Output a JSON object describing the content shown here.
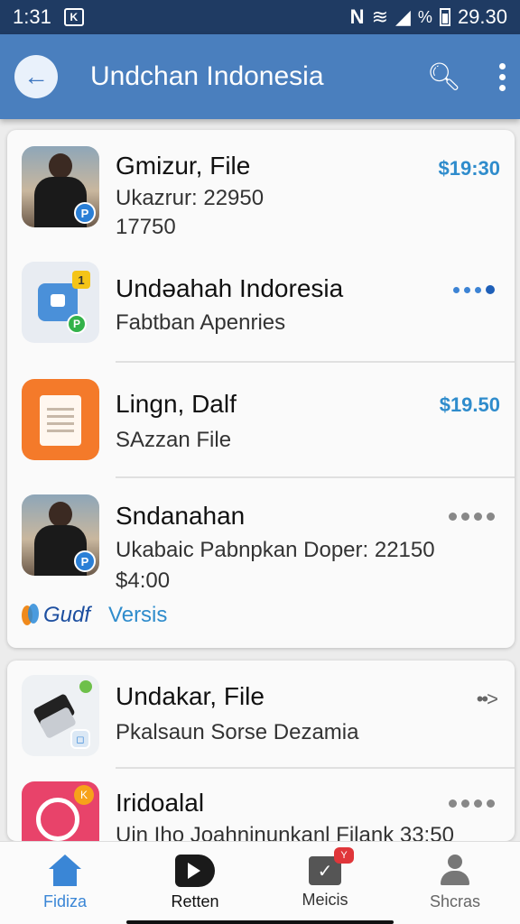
{
  "status_bar": {
    "time": "1:31",
    "notification": "K",
    "network": "N",
    "wifi": "≋",
    "signal": "◢",
    "percent": "%",
    "clock": "29.30"
  },
  "app_bar": {
    "title": "Undchan Indonesia",
    "back_icon": "arrow-left-icon",
    "search_icon": "search-icon",
    "menu_icon": "more-vertical-icon"
  },
  "list": [
    {
      "title": "Gmizur, File",
      "subtitle": "Ukazrur: 22950",
      "subtitle2": "17750",
      "price": "$19:30",
      "badge": "P"
    },
    {
      "title": "Undəahah Indoresia",
      "subtitle": "Fabtban Apenries",
      "badge_top": "1",
      "badge_bottom": "P"
    },
    {
      "title": "Lingn, Dalf",
      "subtitle": "SAzzan File",
      "price": "$19.50"
    },
    {
      "title": "Sndanahan",
      "subtitle": "Ukabaic Pabnpkan Doper: 22150",
      "subtitle2": "$4:00",
      "badge": "P"
    },
    {
      "title": "Undakar, File",
      "subtitle": "Pkalsaun Sorse Dezamia",
      "more": "••>",
      "badge": "◻"
    },
    {
      "title": "Iridoalal",
      "subtitle": "Uin Iho Joahninunkanl Filank 33:50",
      "badge": "K"
    }
  ],
  "footer": {
    "brand": "Gudf",
    "link": "Versis"
  },
  "bottom_nav": [
    {
      "label": "Fidiza",
      "icon": "home-icon"
    },
    {
      "label": "Retten",
      "icon": "return-icon"
    },
    {
      "label": "Meicis",
      "icon": "message-icon",
      "badge": "Y"
    },
    {
      "label": "Shcras",
      "icon": "user-icon"
    }
  ],
  "colors": {
    "status_bar": "#1f3b63",
    "app_bar": "#4a7fbe",
    "accent": "#2f8ccc",
    "nav_active": "#3a86d6"
  }
}
